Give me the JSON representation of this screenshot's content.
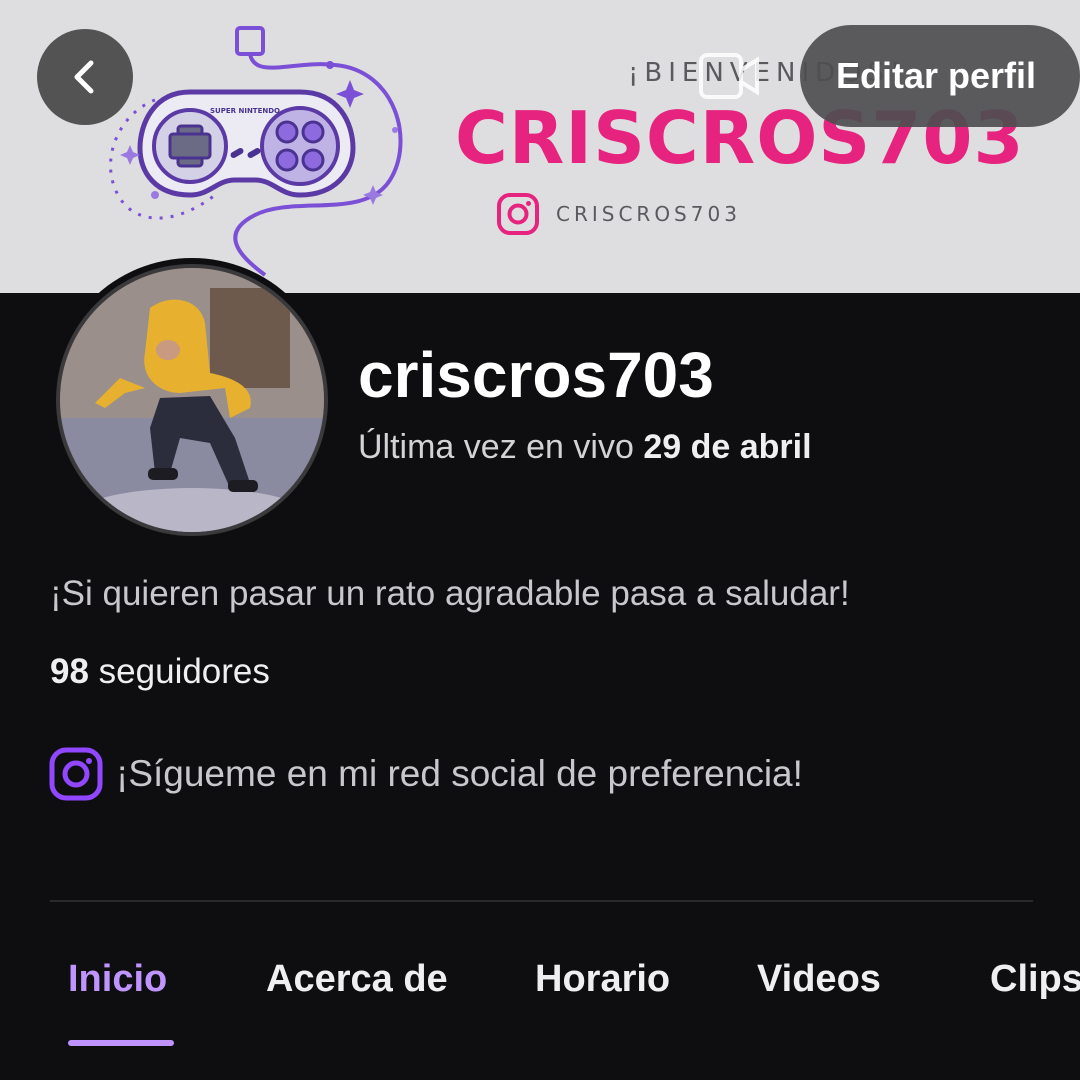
{
  "banner": {
    "welcome": "¡BIENVENIDOS!",
    "channel_name": "CRISCROS703",
    "instagram_handle": "CRISCROS703",
    "controller_label": "SUPER NINTENDO",
    "brand_color": "#e6247f"
  },
  "header": {
    "back_icon": "chevron-left-icon",
    "edit_label": "Editar perfil"
  },
  "profile": {
    "username": "criscros703",
    "last_live_prefix": "Última vez en vivo",
    "last_live_date": "29 de abril",
    "bio": "¡Si quieren pasar un rato agradable pasa a saludar!",
    "followers_count": "98",
    "followers_label": "seguidores",
    "social_icon": "instagram-icon",
    "social_text": "¡Sígueme en mi red social de preferencia!"
  },
  "tabs": [
    {
      "label": "Inicio",
      "active": true
    },
    {
      "label": "Acerca de",
      "active": false
    },
    {
      "label": "Horario",
      "active": false
    },
    {
      "label": "Videos",
      "active": false
    },
    {
      "label": "Clips",
      "active": false
    }
  ],
  "colors": {
    "accent": "#bf94ff",
    "background": "#0e0e10",
    "instagram_purple": "#9147ff"
  }
}
